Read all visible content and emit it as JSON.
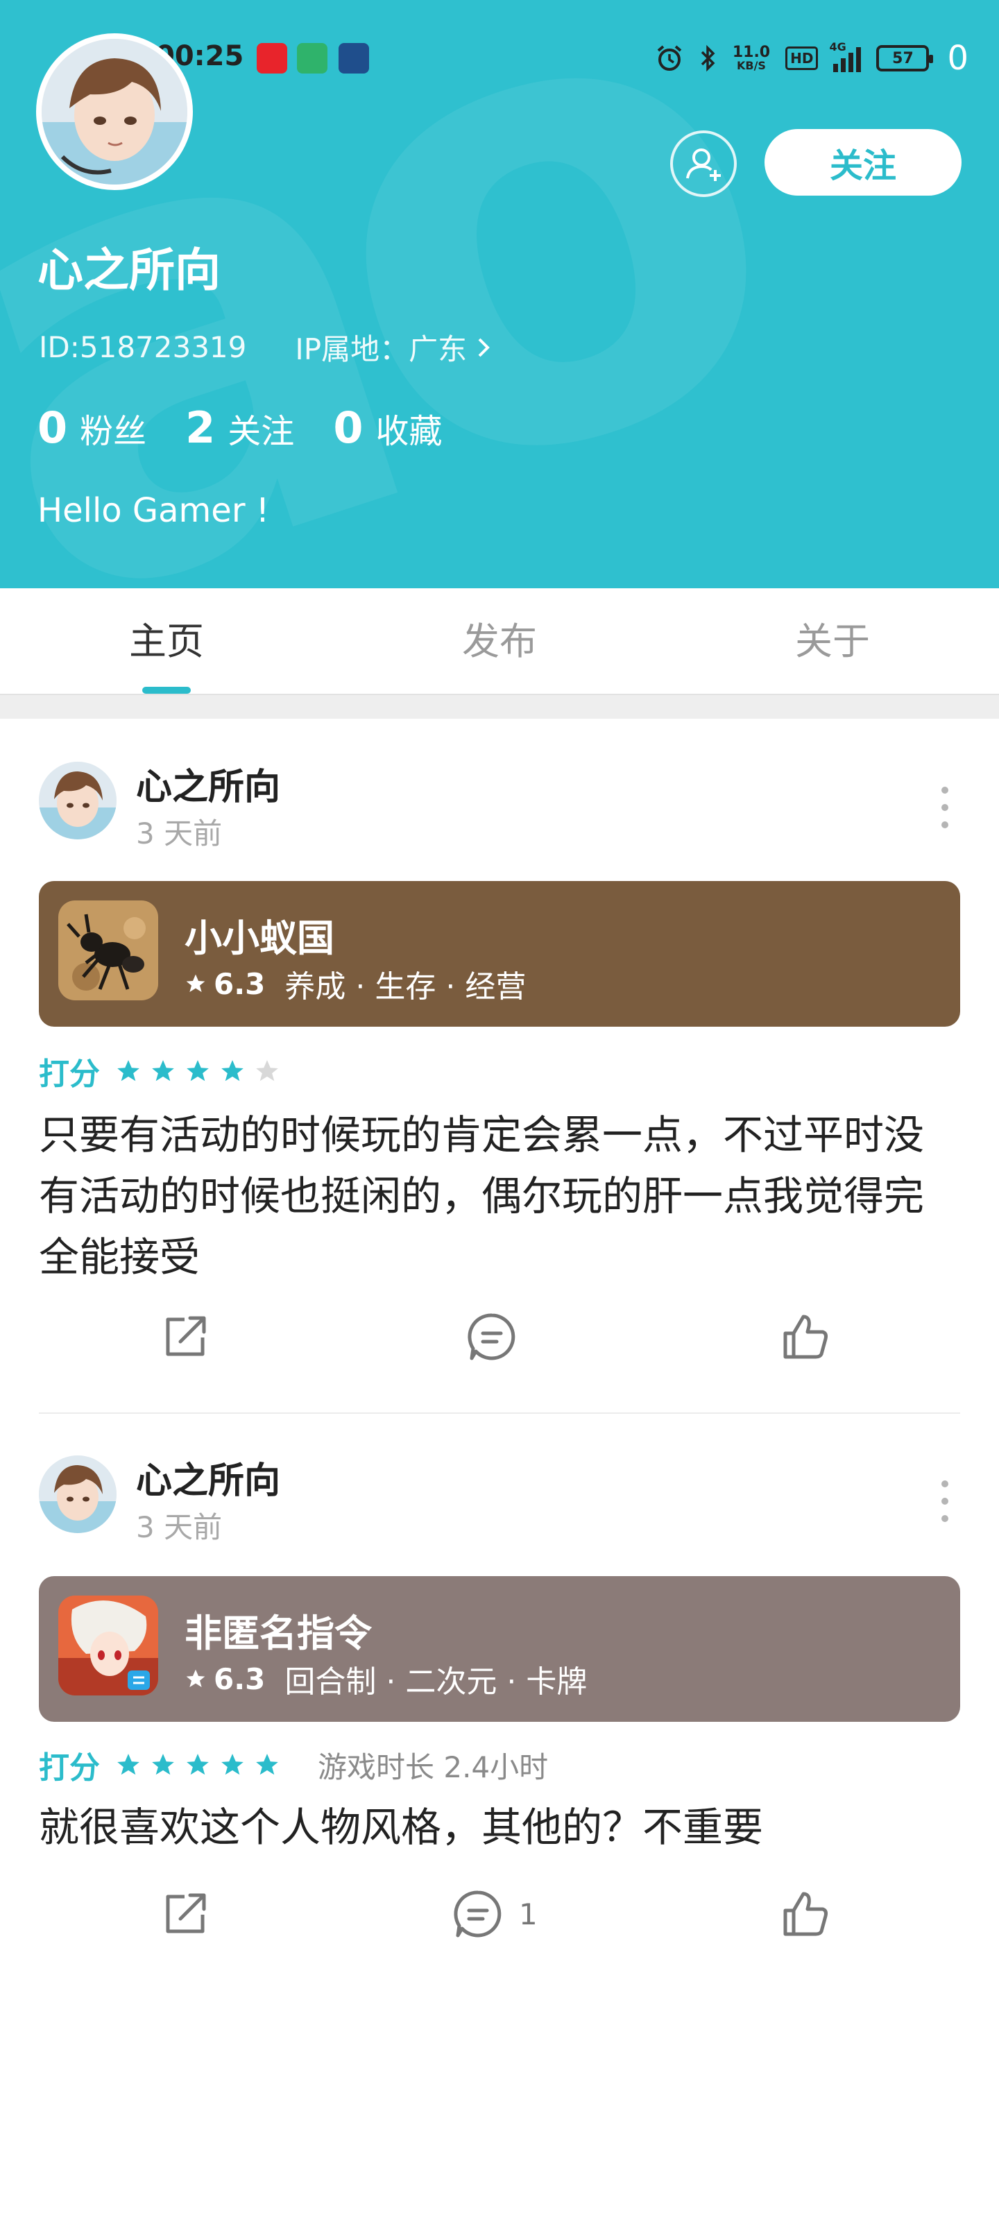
{
  "status_bar": {
    "time": "00:25",
    "network_speed": "11.0",
    "network_speed_unit": "KB/S",
    "hd_label": "HD",
    "signal_label": "4G",
    "battery": "57",
    "extra": "0",
    "app_icon_colors": [
      "#e8242b",
      "#2fb36b",
      "#1f4e8c"
    ]
  },
  "profile": {
    "name": "心之所向",
    "id_text": "ID:518723319",
    "ip_text": "IP属地：广东",
    "follow_button": "关注",
    "stats": [
      {
        "num": "0",
        "label": "粉丝"
      },
      {
        "num": "2",
        "label": "关注"
      },
      {
        "num": "0",
        "label": "收藏"
      }
    ],
    "bio": "Hello Gamer !"
  },
  "tabs": [
    {
      "label": "主页",
      "active": true
    },
    {
      "label": "发布",
      "active": false
    },
    {
      "label": "关于",
      "active": false
    }
  ],
  "posts": [
    {
      "author": "心之所向",
      "time": "3 天前",
      "game": {
        "title": "小小蚁国",
        "rating": "6.3",
        "tags": "养成 · 生存 · 经营",
        "card_color": "#7a5c3e"
      },
      "rating_label": "打分",
      "stars": 4,
      "max_stars": 5,
      "playtime": "",
      "text": "只要有活动的时候玩的肯定会累一点，不过平时没有活动的时候也挺闲的，偶尔玩的肝一点我觉得完全能接受",
      "comment_count": ""
    },
    {
      "author": "心之所向",
      "time": "3 天前",
      "game": {
        "title": "非匿名指令",
        "rating": "6.3",
        "tags": "回合制 · 二次元 · 卡牌",
        "card_color": "#8b7b78"
      },
      "rating_label": "打分",
      "stars": 5,
      "max_stars": 5,
      "playtime": "游戏时长 2.4小时",
      "text": "就很喜欢这个人物风格，其他的？不重要",
      "comment_count": "1"
    }
  ],
  "colors": {
    "accent": "#2bbccb",
    "header_bg": "#2fc0cf",
    "star_empty": "#d8d8d8"
  }
}
